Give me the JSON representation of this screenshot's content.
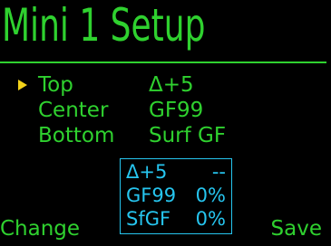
{
  "colors": {
    "title": "#2fd12f",
    "text": "#2fd12f",
    "cursor": "#f2d21a",
    "info": "#26c5ef",
    "background": "#000000"
  },
  "screen": {
    "title": "Mini 1 Setup"
  },
  "menu": {
    "items": [
      {
        "label": "Top",
        "value": "Δ+5",
        "selected": true,
        "cursor_icon": "right-triangle-cursor"
      },
      {
        "label": "Center",
        "value": "GF99",
        "selected": false
      },
      {
        "label": "Bottom",
        "value": "Surf GF",
        "selected": false
      }
    ]
  },
  "info_box": {
    "rows": [
      {
        "label": "Δ+5",
        "value": "--"
      },
      {
        "label": "GF99",
        "value": "0%"
      },
      {
        "label": "SfGF",
        "value": "0%"
      }
    ]
  },
  "softkeys": {
    "left": "Change",
    "right": "Save"
  }
}
